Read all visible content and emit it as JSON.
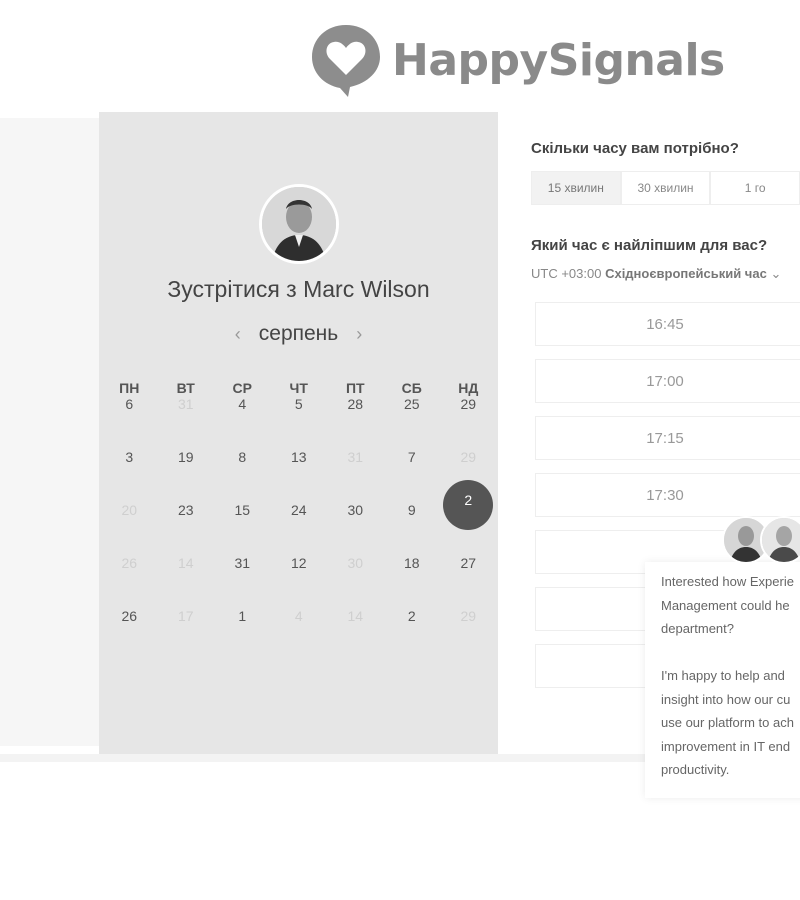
{
  "brand": {
    "name": "HappySignals"
  },
  "calendar": {
    "host_title": "Зустрітися з Marc Wilson",
    "month": "серпень",
    "weekdays": [
      "ПН",
      "ВТ",
      "СР",
      "ЧТ",
      "ПТ",
      "СБ",
      "НД"
    ],
    "weeks": [
      [
        {
          "d": "6"
        },
        {
          "d": "31",
          "muted": true
        },
        {
          "d": "4"
        },
        {
          "d": "5"
        },
        {
          "d": "28"
        },
        {
          "d": "25"
        },
        {
          "d": "29"
        }
      ],
      [
        {
          "d": "3"
        },
        {
          "d": "19"
        },
        {
          "d": "8"
        },
        {
          "d": "13"
        },
        {
          "d": "31",
          "muted": true
        },
        {
          "d": "7"
        },
        {
          "d": "29",
          "muted": true
        }
      ],
      [
        {
          "d": "20",
          "muted": true
        },
        {
          "d": "23"
        },
        {
          "d": "15"
        },
        {
          "d": "24"
        },
        {
          "d": "30"
        },
        {
          "d": "9"
        },
        {
          "d": "2",
          "selected": true
        }
      ],
      [
        {
          "d": "26",
          "muted": true
        },
        {
          "d": "14",
          "muted": true
        },
        {
          "d": "31"
        },
        {
          "d": "12"
        },
        {
          "d": "30",
          "muted": true
        },
        {
          "d": "18"
        },
        {
          "d": "27"
        }
      ],
      [
        {
          "d": "26"
        },
        {
          "d": "17",
          "muted": true
        },
        {
          "d": "1"
        },
        {
          "d": "4",
          "muted": true
        },
        {
          "d": "14",
          "muted": true
        },
        {
          "d": "2"
        },
        {
          "d": "29",
          "muted": true
        }
      ]
    ]
  },
  "booking": {
    "duration_question": "Скільки часу вам потрібно?",
    "durations": [
      "15 хвилин",
      "30 хвилин",
      "1 го"
    ],
    "time_question": "Який час є найліпшим для вас?",
    "tz_offset": "UTC +03:00",
    "tz_name": "Східноєвропейський час",
    "slots": [
      "16:45",
      "17:00",
      "17:15",
      "17:30"
    ]
  },
  "chat": {
    "lines": [
      "Interested how Experie",
      "Management could he",
      "department?",
      "",
      "I'm happy to help and",
      "insight into how our cu",
      "use our platform to ach",
      "improvement in IT end",
      "productivity."
    ]
  }
}
